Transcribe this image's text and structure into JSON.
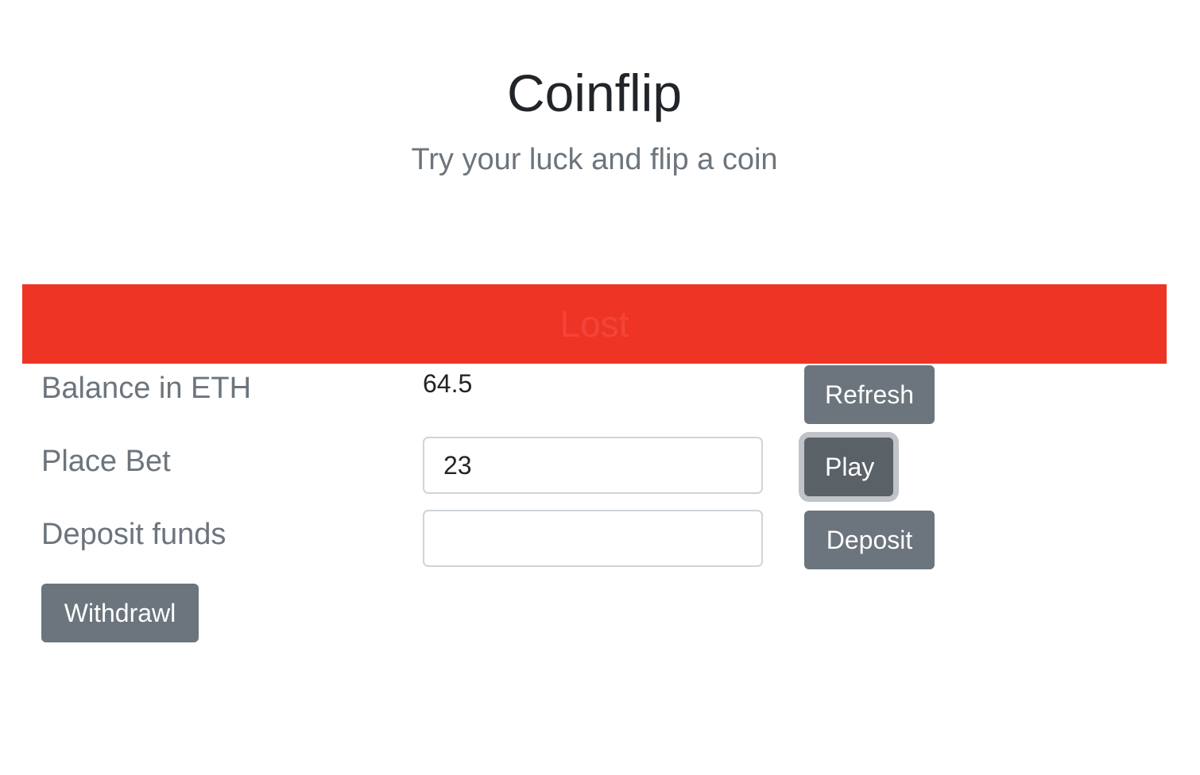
{
  "header": {
    "title": "Coinflip",
    "subtitle": "Try your luck and flip a coin"
  },
  "result": {
    "text": "Lost",
    "banner_color": "#ee3424"
  },
  "balance": {
    "label": "Balance in ETH",
    "value": "64.5",
    "refresh_label": "Refresh"
  },
  "bet": {
    "label": "Place Bet",
    "input_value": "23",
    "play_label": "Play"
  },
  "deposit": {
    "label": "Deposit funds",
    "input_value": "",
    "deposit_label": "Deposit"
  },
  "withdraw": {
    "label": "Withdrawl"
  },
  "colors": {
    "button": "#6c757d",
    "button_focused": "#5a6268",
    "muted_text": "#6c757d"
  }
}
